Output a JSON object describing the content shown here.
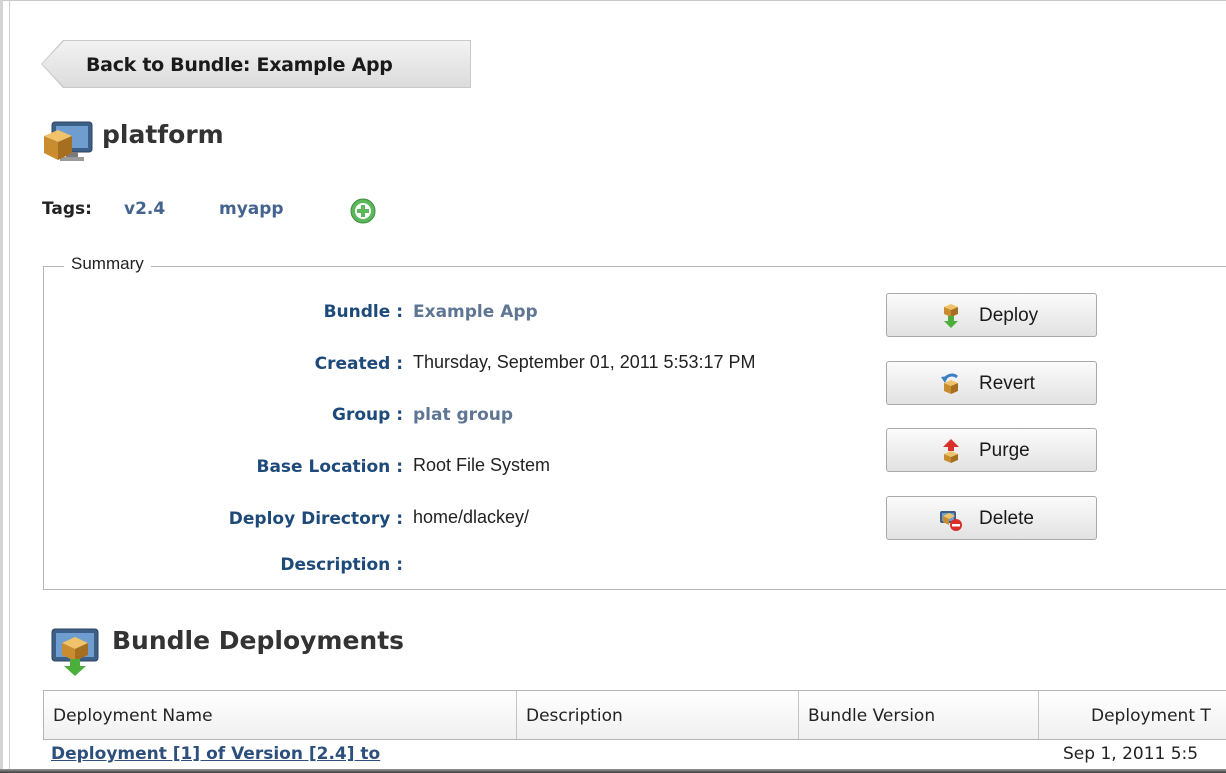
{
  "nav": {
    "back_label": "Back to Bundle: Example App"
  },
  "header": {
    "title": "platform",
    "icon": "bundle-destination-icon"
  },
  "tags": {
    "label": "Tags:",
    "items": [
      "v2.4",
      "myapp"
    ],
    "add_icon": "add-circle-icon"
  },
  "summary": {
    "legend": "Summary",
    "fields": [
      {
        "label": "Bundle :",
        "value": "Example App",
        "link": true
      },
      {
        "label": "Created :",
        "value": "Thursday, September 01, 2011 5:53:17 PM",
        "link": false
      },
      {
        "label": "Group :",
        "value": "plat group",
        "link": true
      },
      {
        "label": "Base Location :",
        "value": "Root File System",
        "link": false
      },
      {
        "label": "Deploy Directory :",
        "value": "home/dlackey/",
        "link": false
      },
      {
        "label": "Description :",
        "value": "",
        "link": false
      }
    ],
    "actions": [
      {
        "label": "Deploy",
        "icon": "deploy-icon"
      },
      {
        "label": "Revert",
        "icon": "revert-icon"
      },
      {
        "label": "Purge",
        "icon": "purge-icon"
      },
      {
        "label": "Delete",
        "icon": "delete-icon"
      }
    ]
  },
  "deployments": {
    "title": "Bundle Deployments",
    "icon": "bundle-deployments-icon",
    "columns": [
      "Deployment Name",
      "Description",
      "Bundle Version",
      "Deployment T"
    ],
    "rows": [
      {
        "name": "Deployment [1] of Version [2.4] to",
        "description": "",
        "version": "",
        "time": "Sep 1, 2011 5:5"
      }
    ]
  },
  "colors": {
    "label_blue": "#1e4a7a",
    "link_blue": "#5e7694",
    "title_gray": "#333333"
  }
}
